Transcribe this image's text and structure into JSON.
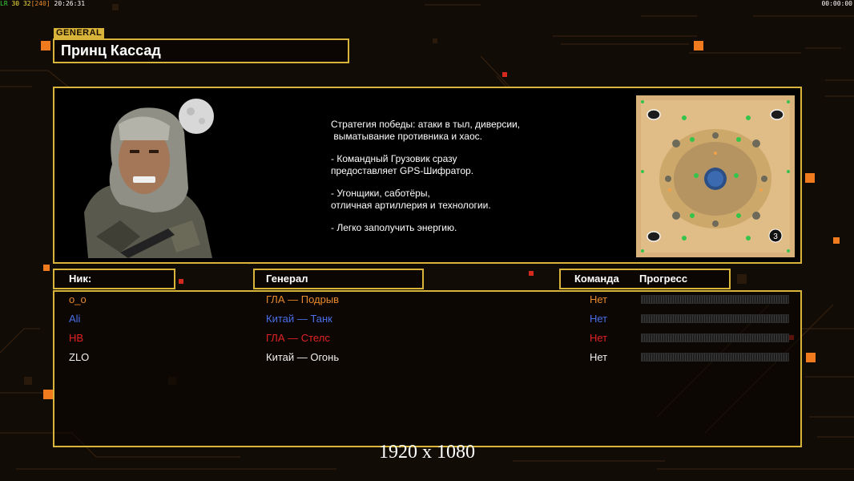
{
  "topbar": {
    "fps_prefix": "LR",
    "fps1": "30",
    "fps2": "32",
    "fps3": "[240]",
    "clock_left": "20:26:31",
    "clock_right": "00:00:00"
  },
  "general": {
    "tag": "GENERAL",
    "name": "Принц Кассад"
  },
  "description": {
    "lines": [
      "Стратегия победы: атаки в тыл, диверсии,",
      " выматывание противника и хаос.",
      "- Командный Грузовик сразу",
      "предоставляет GPS-Шифратор.",
      "- Угонщики, саботёры,",
      "отличная артиллерия и технологии.",
      "- Легко заполучить энергию."
    ]
  },
  "map": {
    "players_label": "3"
  },
  "headers": {
    "nick": "Ник:",
    "general": "Генерал",
    "team": "Команда",
    "progress": "Прогресс"
  },
  "players": [
    {
      "nick": "o_o",
      "general": "ГЛА — Подрыв",
      "team": "Нет",
      "color": "#e8892c",
      "progress": 0
    },
    {
      "nick": "Ali",
      "general": "Китай — Танк",
      "team": "Нет",
      "color": "#4a6fe8",
      "progress": 0
    },
    {
      "nick": "HB",
      "general": "ГЛА — Стелс",
      "team": "Нет",
      "color": "#e22222",
      "progress": 0
    },
    {
      "nick": "ZLO",
      "general": "Китай — Огонь",
      "team": "Нет",
      "color": "#f0f0f0",
      "progress": 0
    }
  ],
  "resolution_caption": "1920 x 1080",
  "colors": {
    "accent": "#d9b43a",
    "orange": "#f07a1e",
    "red": "#d42a1e"
  }
}
